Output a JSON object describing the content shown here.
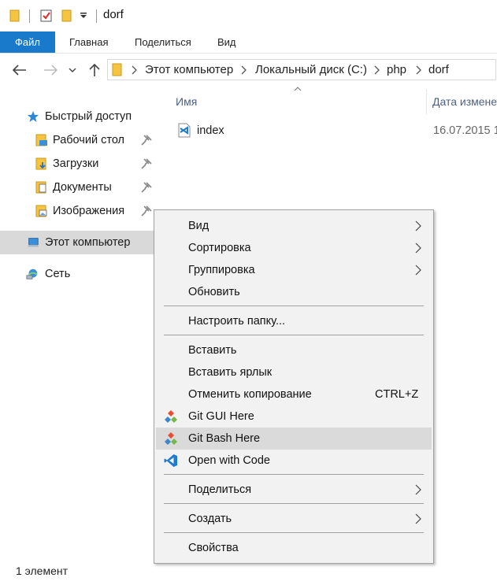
{
  "window": {
    "title": "dorf"
  },
  "ribbon": {
    "tabs": [
      "Файл",
      "Главная",
      "Поделиться",
      "Вид"
    ]
  },
  "address": {
    "crumbs": [
      "Этот компьютер",
      "Локальный диск (C:)",
      "php",
      "dorf"
    ]
  },
  "nav": {
    "quick_access": "Быстрый доступ",
    "items": [
      "Рабочий стол",
      "Загрузки",
      "Документы",
      "Изображения"
    ],
    "this_pc": "Этот компьютер",
    "network": "Сеть"
  },
  "files": {
    "columns": {
      "name": "Имя",
      "date": "Дата изменен"
    },
    "rows": [
      {
        "name": "index",
        "date": "16.07.2015 1"
      }
    ]
  },
  "status": {
    "count": "1 элемент"
  },
  "context_menu": {
    "view": "Вид",
    "sort": "Сортировка",
    "group": "Группировка",
    "refresh": "Обновить",
    "customize": "Настроить папку...",
    "paste": "Вставить",
    "paste_shortcut": "Вставить ярлык",
    "undo_copy": "Отменить копирование",
    "undo_copy_key": "CTRL+Z",
    "git_gui": "Git GUI Here",
    "git_bash": "Git Bash Here",
    "open_code": "Open with Code",
    "share": "Поделиться",
    "create": "Создать",
    "properties": "Свойства"
  },
  "colors": {
    "file_tab": "#1979ca",
    "menu_bg": "#f2f2f2",
    "menu_highlight": "#dadada",
    "folder": "#f5c542"
  }
}
